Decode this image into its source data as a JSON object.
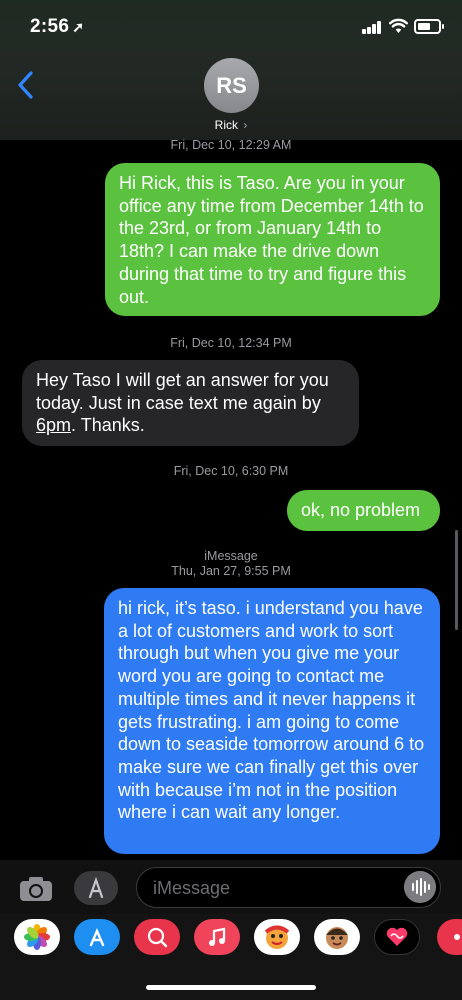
{
  "status_bar": {
    "time": "2:56",
    "location_glyph": "➚"
  },
  "header": {
    "avatar_initials": "RS",
    "contact_name": "Rick",
    "chevron": "›"
  },
  "timestamps": [
    "Fri, Dec 10, 12:29 AM",
    "Fri, Dec 10, 12:34 PM",
    "Fri, Dec 10, 6:30 PM",
    "iMessage",
    "Thu, Jan 27, 9:55 PM"
  ],
  "messages": [
    {
      "from": "me",
      "color": "#5bc23f",
      "text": "Hi Rick, this is Taso. Are you in your office any time from December 14th to the 23rd, or from January 14th to 18th? I can make the drive down during that time to try and figure this out."
    },
    {
      "from": "Rick",
      "color": "#262628",
      "text": "Hey Taso I will get an answer for you today. Just in case text me again by",
      "link": "6pm",
      "text_after": ". Thanks."
    },
    {
      "from": "me",
      "color": "#5bc23f",
      "text": "ok, no problem"
    },
    {
      "from": "me",
      "color": "#2e7bf4",
      "text": "hi rick, it’s taso. i understand you have a lot of customers and work to sort through but when you give me your word you are going to contact me multiple times and it never happens it gets frustrating. i am going to come down to seaside tomorrow around 6 to make sure we can finally get this over with because i’m not in the position where i can wait any longer."
    }
  ],
  "input": {
    "placeholder": "iMessage"
  },
  "app_tray": [
    "photos-icon",
    "app-store-icon",
    "web-search-icon",
    "music-icon",
    "memoji-icon",
    "memoji-2-icon",
    "digital-touch-icon",
    "more-apps-icon"
  ]
}
